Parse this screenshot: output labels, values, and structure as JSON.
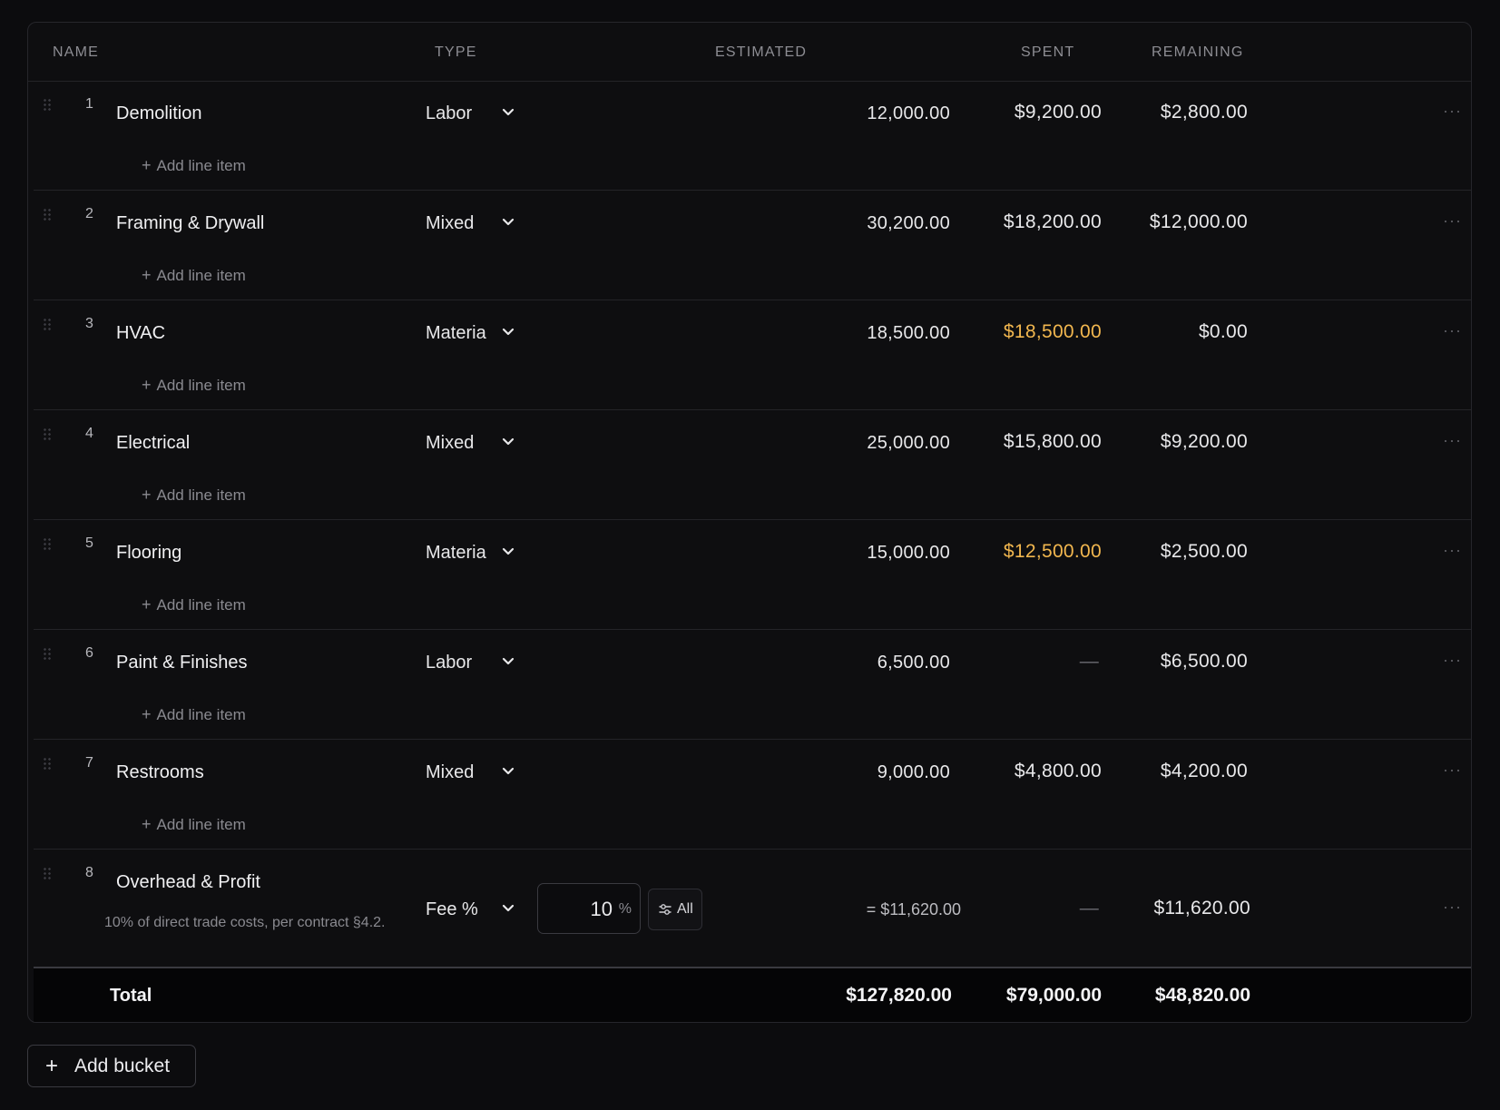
{
  "columns": {
    "name": "NAME",
    "type": "TYPE",
    "estimated": "ESTIMATED",
    "spent": "SPENT",
    "remaining": "REMAINING"
  },
  "add_line_label": "Add line item",
  "more_icon": "···",
  "buckets": [
    {
      "num": "1",
      "name": "Demolition",
      "type": "Labor",
      "estimated": "12,000.00",
      "spent": "$9,200.00",
      "remaining": "$2,800.00"
    },
    {
      "num": "2",
      "name": "Framing & Drywall",
      "type": "Mixed",
      "estimated": "30,200.00",
      "spent": "$18,200.00",
      "remaining": "$12,000.00"
    },
    {
      "num": "3",
      "name": "HVAC",
      "type": "Materia",
      "estimated": "18,500.00",
      "spent": "$18,500.00",
      "remaining": "$0.00"
    },
    {
      "num": "4",
      "name": "Electrical",
      "type": "Mixed",
      "estimated": "25,000.00",
      "spent": "$15,800.00",
      "remaining": "$9,200.00"
    },
    {
      "num": "5",
      "name": "Flooring",
      "type": "Materia",
      "estimated": "15,000.00",
      "spent": "$12,500.00",
      "remaining": "$2,500.00"
    },
    {
      "num": "6",
      "name": "Paint & Finishes",
      "type": "Labor",
      "estimated": "6,500.00",
      "spent": "—",
      "remaining": "$6,500.00"
    },
    {
      "num": "7",
      "name": "Restrooms",
      "type": "Mixed",
      "estimated": "9,000.00",
      "spent": "$4,800.00",
      "remaining": "$4,200.00"
    }
  ],
  "fee_bucket": {
    "num": "8",
    "name": "Overhead & Profit",
    "description": "10% of direct trade costs, per contract §4.2.",
    "type": "Fee %",
    "percent": "10",
    "percent_symbol": "%",
    "scope_label": "All",
    "estimated": "= $11,620.00",
    "spent": "—",
    "remaining": "$11,620.00"
  },
  "totals": {
    "label": "Total",
    "estimated": "$127,820.00",
    "spent": "$79,000.00",
    "remaining": "$48,820.00"
  },
  "add_bucket_label": "Add bucket",
  "colors": {
    "background": "#0c0c0e",
    "over_budget": "#f2b74f",
    "text": "#e8e8ea",
    "muted": "#8a8a90"
  }
}
